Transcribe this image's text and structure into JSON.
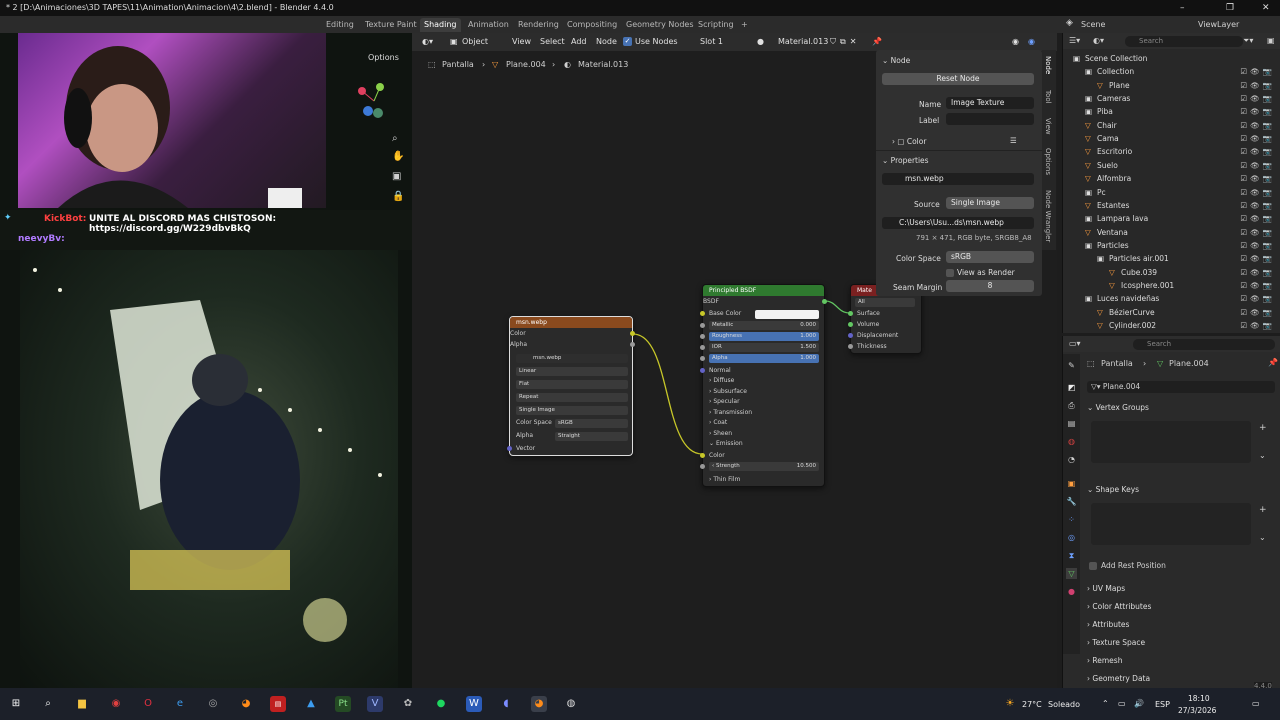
{
  "window": {
    "title": "* 2 [D:\\Animaciones\\3D TAPES\\11\\Animation\\Animacion\\4\\2.blend] - Blender 4.4.0",
    "minimize": "–",
    "maximize": "❐",
    "close": "✕"
  },
  "workspaces": {
    "tabs": [
      "Editing",
      "Texture Paint",
      "Shading",
      "Animation",
      "Rendering",
      "Compositing",
      "Geometry Nodes",
      "Scripting"
    ],
    "active": "Shading",
    "add": "+"
  },
  "scene_selector": {
    "label": "Scene"
  },
  "viewlayer_selector": {
    "label": "ViewLayer"
  },
  "stream_overlay": {
    "chat_line1_user": "KickBot:",
    "chat_line1_text": "UNITE AL DISCORD MAS CHISTOSON: https://discord.gg/W229dbvBkQ",
    "chat_line2_user": "neevyBv:",
    "viewport_options": "Options"
  },
  "node_editor_header": {
    "object_mode": "Object",
    "menus": [
      "View",
      "Select",
      "Add",
      "Node"
    ],
    "use_nodes_label": "Use Nodes",
    "slot": "Slot 1",
    "material": "Material.013"
  },
  "breadcrumb": [
    "Pantalla",
    "Plane.004",
    "Material.013"
  ],
  "image_node": {
    "title": "msn.webp",
    "outputs": [
      "Color",
      "Alpha"
    ],
    "image_name": "msn.webp",
    "interpolation": "Linear",
    "projection": "Flat",
    "extension": "Repeat",
    "source": "Single Image",
    "color_space_label": "Color Space",
    "color_space": "sRGB",
    "alpha_label": "Alpha",
    "alpha": "Straight",
    "vector_input": "Vector"
  },
  "bsdf_node": {
    "title": "Principled BSDF",
    "output": "BSDF",
    "base_color": "Base Color",
    "fields": [
      {
        "label": "Metallic",
        "value": "0.000"
      },
      {
        "label": "Roughness",
        "value": "1.000"
      },
      {
        "label": "IOR",
        "value": "1.500"
      },
      {
        "label": "Alpha",
        "value": "1.000"
      }
    ],
    "normal": "Normal",
    "panels": [
      "Diffuse",
      "Subsurface",
      "Specular",
      "Transmission",
      "Coat",
      "Sheen",
      "Emission"
    ],
    "emission_color": "Color",
    "strength_label": "Strength",
    "strength_value": "10.500",
    "thin_film": "Thin Film"
  },
  "output_node": {
    "title": "Mate",
    "target": "All",
    "inputs": [
      "Surface",
      "Volume",
      "Displacement",
      "Thickness"
    ]
  },
  "n_panel": {
    "node_section": "Node",
    "reset_button": "Reset Node",
    "name_label": "Name",
    "name_value": "Image Texture",
    "label_label": "Label",
    "color_section": "Color",
    "properties_section": "Properties",
    "image_name": "msn.webp",
    "source_label": "Source",
    "source_value": "Single Image",
    "filepath": "C:\\Users\\Usu...ds\\msn.webp",
    "image_info": "791 × 471,  RGB byte, SRGB8_A8",
    "color_space_label": "Color Space",
    "color_space_value": "sRGB",
    "view_as_render": "View as Render",
    "seam_margin_label": "Seam Margin",
    "seam_margin_value": "8"
  },
  "sidebar_tabs": [
    "Node",
    "Tool",
    "View",
    "Options",
    "Node Wrangler"
  ],
  "outliner": {
    "search_placeholder": "Search",
    "items": [
      {
        "label": "Scene Collection",
        "depth": 0,
        "icon": "collection-icon"
      },
      {
        "label": "Collection",
        "depth": 1,
        "icon": "collection-icon"
      },
      {
        "label": "Plane",
        "depth": 2,
        "icon": "object-icon"
      },
      {
        "label": "Cameras",
        "depth": 1,
        "icon": "collection-icon"
      },
      {
        "label": "Piba",
        "depth": 1,
        "icon": "collection-icon"
      },
      {
        "label": "Chair",
        "depth": 1,
        "icon": "object-icon"
      },
      {
        "label": "Cama",
        "depth": 1,
        "icon": "object-icon"
      },
      {
        "label": "Escritorio",
        "depth": 1,
        "icon": "object-icon"
      },
      {
        "label": "Suelo",
        "depth": 1,
        "icon": "object-icon"
      },
      {
        "label": "Alfombra",
        "depth": 1,
        "icon": "object-icon"
      },
      {
        "label": "Pc",
        "depth": 1,
        "icon": "collection-icon"
      },
      {
        "label": "Estantes",
        "depth": 1,
        "icon": "object-icon"
      },
      {
        "label": "Lampara lava",
        "depth": 1,
        "icon": "collection-icon"
      },
      {
        "label": "Ventana",
        "depth": 1,
        "icon": "object-icon"
      },
      {
        "label": "Particles",
        "depth": 1,
        "icon": "collection-icon"
      },
      {
        "label": "Particles air.001",
        "depth": 2,
        "icon": "collection-icon"
      },
      {
        "label": "Cube.039",
        "depth": 3,
        "icon": "object-icon"
      },
      {
        "label": "Icosphere.001",
        "depth": 3,
        "icon": "object-icon"
      },
      {
        "label": "Luces navideñas",
        "depth": 1,
        "icon": "collection-icon"
      },
      {
        "label": "BézierCurve",
        "depth": 2,
        "icon": "object-icon"
      },
      {
        "label": "Cylinder.002",
        "depth": 2,
        "icon": "object-icon"
      }
    ]
  },
  "properties": {
    "search_placeholder": "Search",
    "breadcrumb": [
      "Pantalla",
      "Plane.004"
    ],
    "mesh_name": "Plane.004",
    "sections": [
      "Vertex Groups",
      "Shape Keys"
    ],
    "add_rest_position": "Add Rest Position",
    "collapsed_sections": [
      "UV Maps",
      "Color Attributes",
      "Attributes",
      "Texture Space",
      "Remesh",
      "Geometry Data"
    ]
  },
  "version": "4.4.0",
  "taskbar": {
    "weather_temp": "27°C",
    "weather_text": "Soleado",
    "lang": "ESP",
    "time": "18:10",
    "date": "27/3/2026"
  },
  "colors": {
    "accent_blue": "#4772b3",
    "socket_yellow": "#c7c729",
    "socket_green": "#63c763",
    "bsdf_header": "#2f7a2f",
    "image_header": "#8a4a1e",
    "output_header": "#7a2020"
  }
}
